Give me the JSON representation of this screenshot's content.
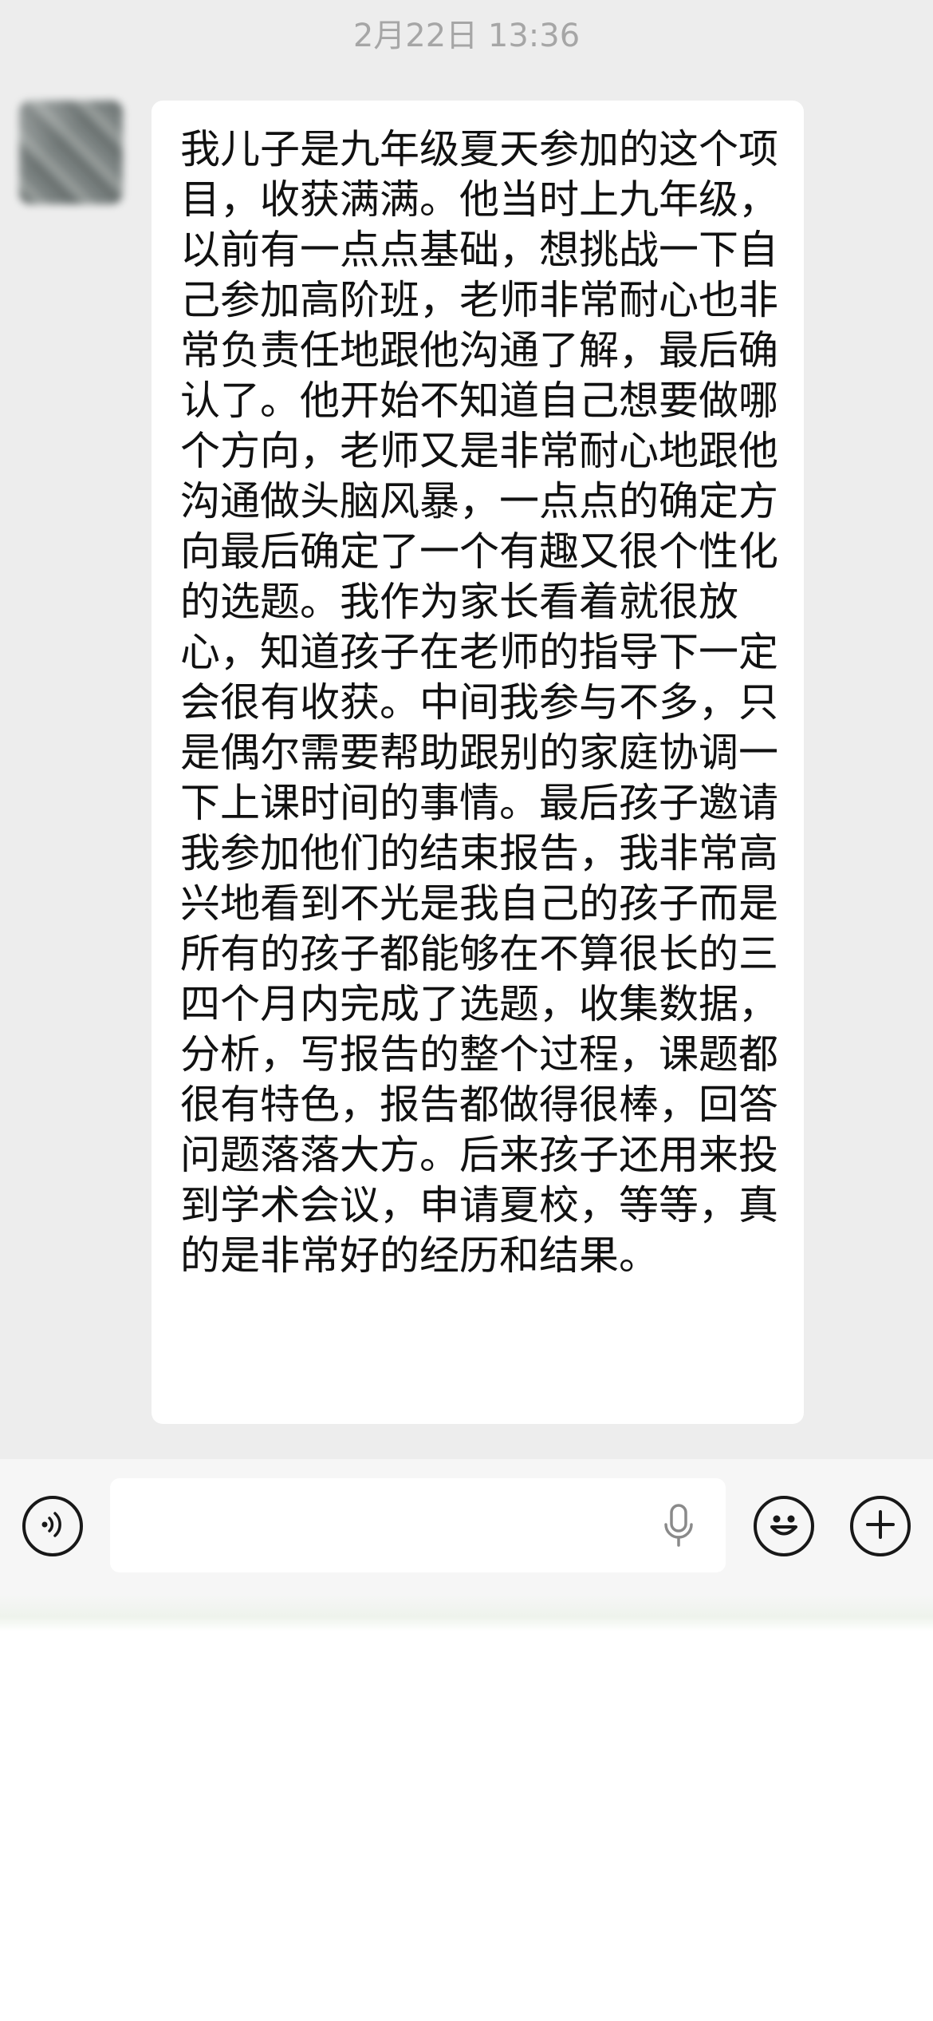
{
  "timestamp": "2月22日 13:36",
  "message": {
    "text": "我儿子是九年级夏天参加的这个项目，收获满满。他当时上九年级，以前有一点点基础，想挑战一下自己参加高阶班，老师非常耐心也非常负责任地跟他沟通了解，最后确认了。他开始不知道自己想要做哪个方向，老师又是非常耐心地跟他沟通做头脑风暴，一点点的确定方向最后确定了一个有趣又很个性化的选题。我作为家长看着就很放心，知道孩子在老师的指导下一定会很有收获。中间我参与不多，只是偶尔需要帮助跟别的家庭协调一下上课时间的事情。最后孩子邀请我参加他们的结束报告，我非常高兴地看到不光是我自己的孩子而是所有的孩子都能够在不算很长的三四个月内完成了选题，收集数据，分析，写报告的整个过程，课题都很有特色，报告都做得很棒，回答问题落落大方。后来孩子还用来投到学术会议，申请夏校，等等，真的是非常好的经历和结果。"
  },
  "input_bar": {
    "voice_icon": "voice-icon",
    "mic_icon": "mic-icon",
    "emoji_icon": "emoji-icon",
    "plus_icon": "plus-icon",
    "input_value": ""
  },
  "colors": {
    "chat_background": "#ededed",
    "bubble": "#ffffff",
    "timestamp_text": "#a6a6a6",
    "input_bar": "#f6f6f6"
  }
}
